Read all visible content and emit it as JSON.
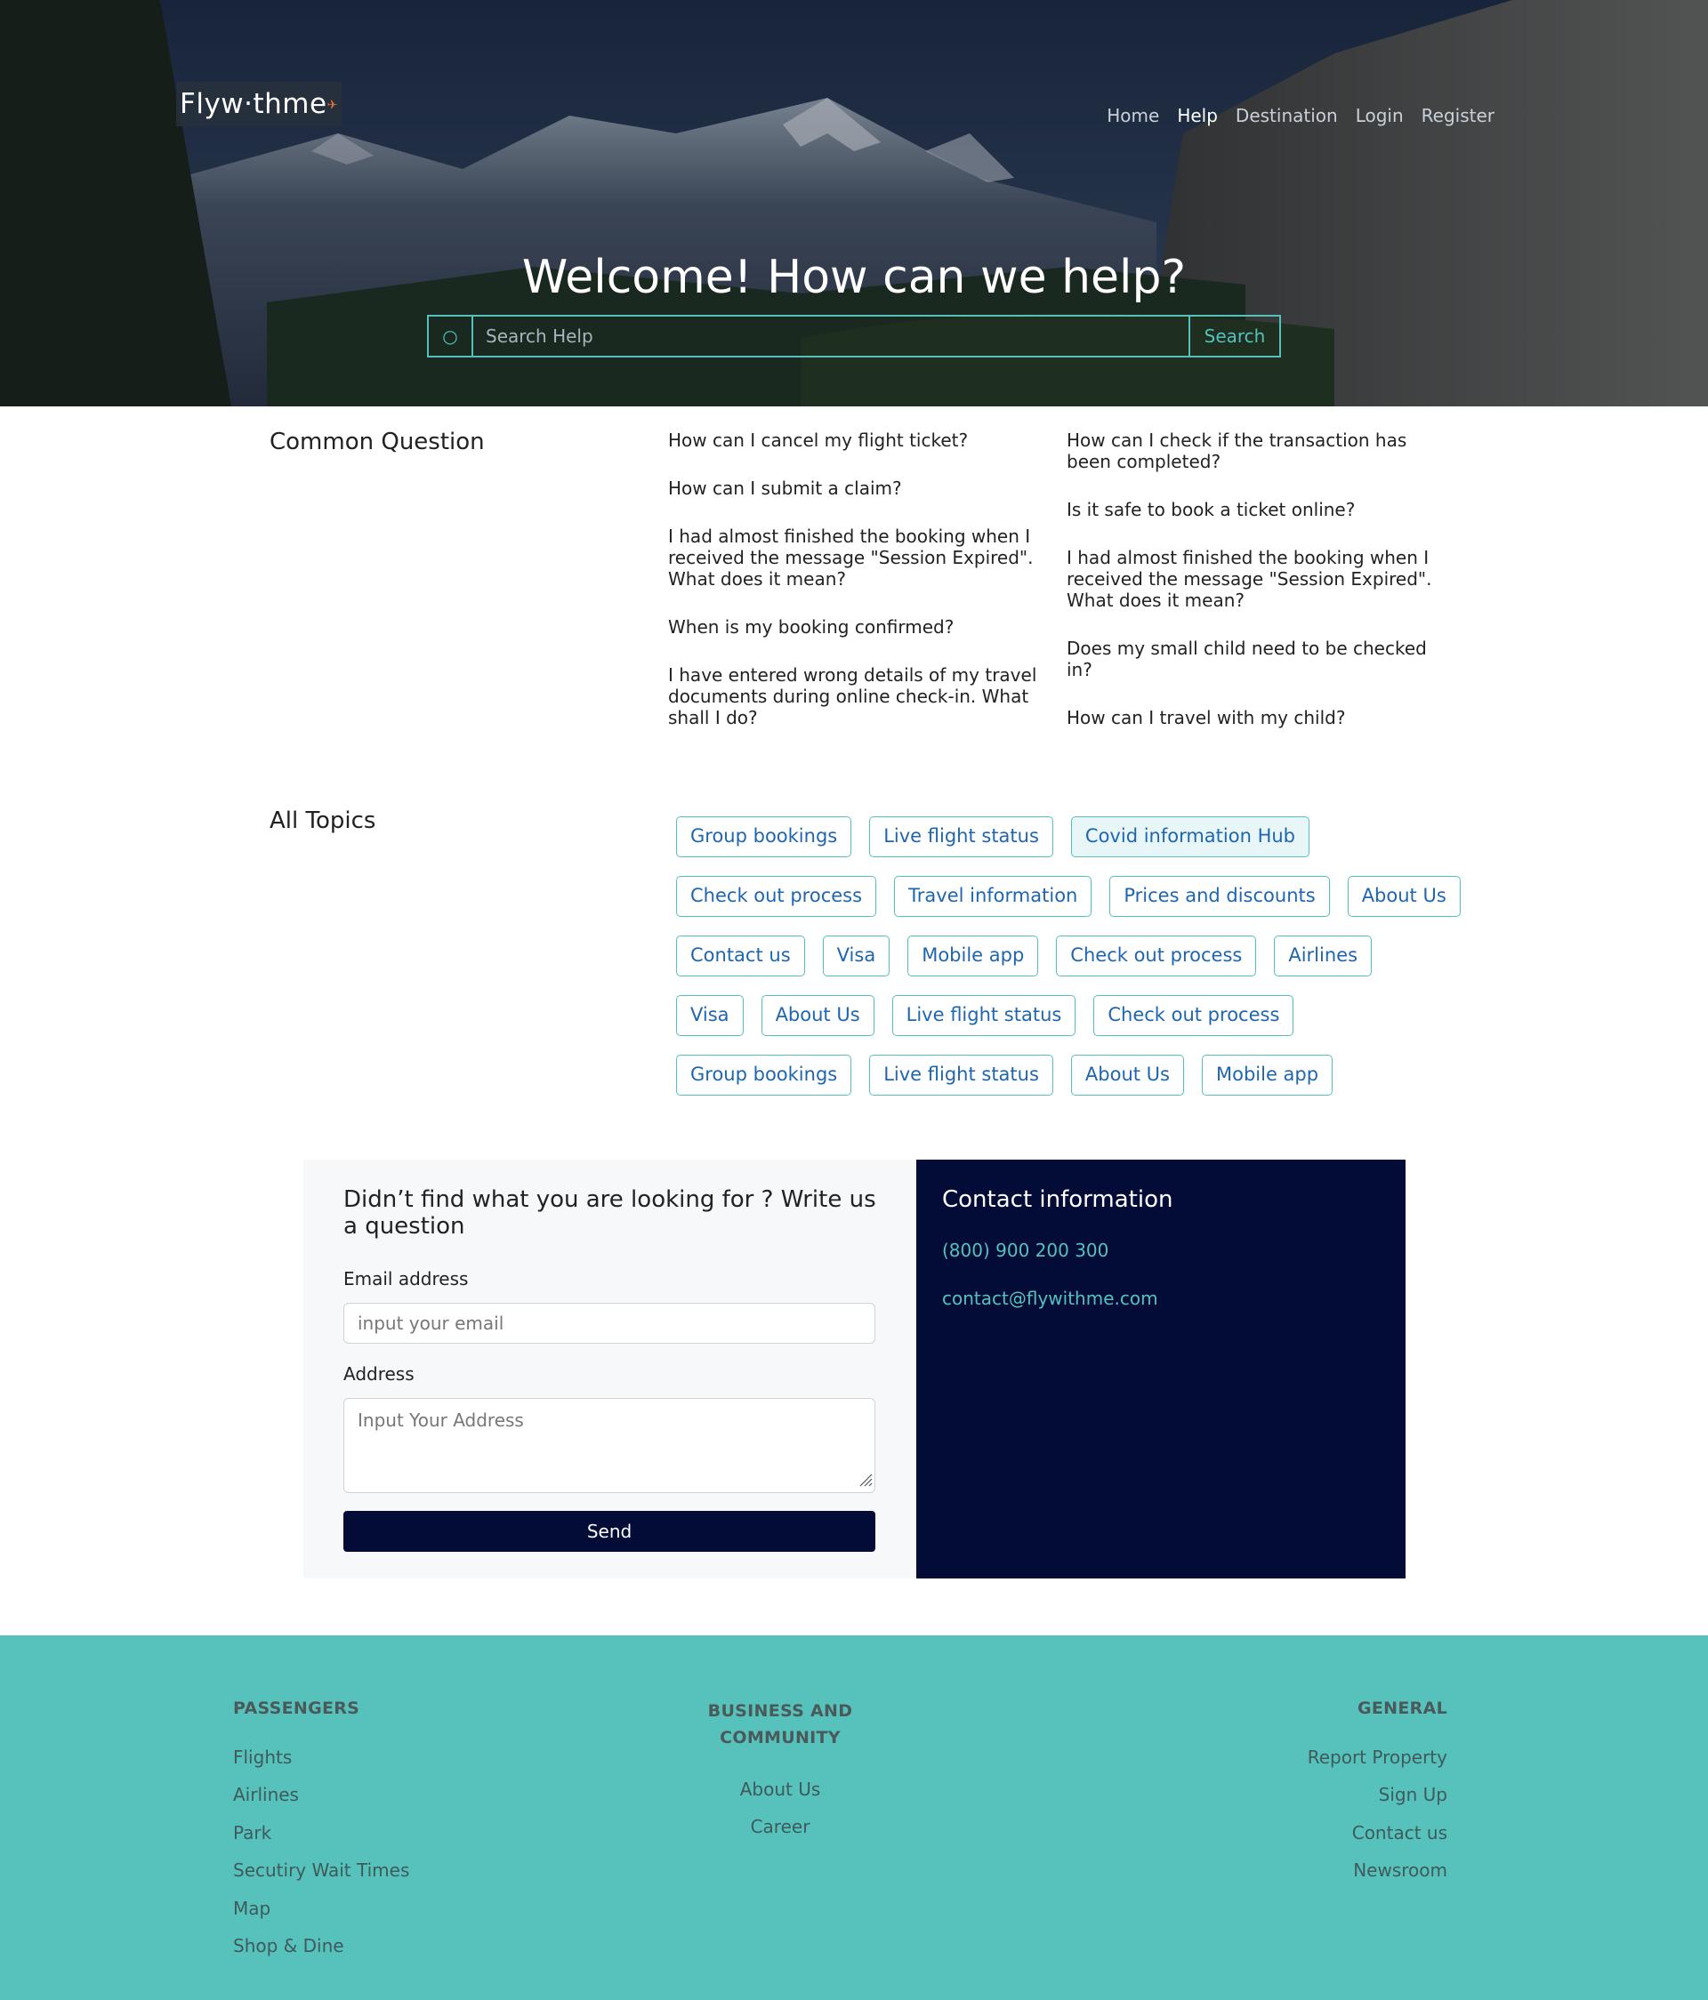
{
  "brand": {
    "logo_text": "Flyw·thme"
  },
  "nav": {
    "items": [
      {
        "label": "Home",
        "active": false
      },
      {
        "label": "Help",
        "active": true
      },
      {
        "label": "Destination",
        "active": false
      },
      {
        "label": "Login",
        "active": false
      },
      {
        "label": "Register",
        "active": false
      }
    ]
  },
  "hero": {
    "title": "Welcome! How can we help?",
    "search_placeholder": "Search Help",
    "search_button": "Search",
    "search_icon": "search-icon"
  },
  "common": {
    "title": "Common Question",
    "left": [
      "How can I cancel my flight ticket?",
      "How can I submit a claim?",
      "I had almost finished the booking when I received the message \"Session Expired\". What does it mean?",
      "When is my booking confirmed?",
      "I have entered wrong details of my travel documents during online check-in. What shall I do?"
    ],
    "right": [
      "How can I check if the transaction has been completed?",
      "Is it safe to book a ticket online?",
      "I had almost finished the booking when I received the message \"Session Expired\". What does it mean?",
      "Does my small child need to be checked in?",
      "How can I travel with my child?"
    ]
  },
  "topics": {
    "title": "All Topics",
    "rows": [
      [
        "Group bookings",
        "Live flight status",
        "Covid information Hub"
      ],
      [
        "Check out process",
        "Travel information",
        "Prices and discounts",
        "About Us"
      ],
      [
        "Contact us",
        "Visa",
        "Mobile app",
        "Check out process",
        "Airlines"
      ],
      [
        "Visa",
        "About Us",
        "Live flight status",
        "Check out process"
      ],
      [
        "Group bookings",
        "Live flight status",
        "About Us",
        "Mobile app"
      ]
    ],
    "highlighted": "Covid information Hub"
  },
  "ask": {
    "title": "Didn’t find what you are looking for ? Write us a question",
    "email_label": "Email address",
    "email_placeholder": "input your email",
    "address_label": "Address",
    "address_placeholder": "Input Your Address",
    "send_label": "Send"
  },
  "contact": {
    "title": "Contact information",
    "phone": "(800) 900 200 300",
    "email": "contact@flywithme.com"
  },
  "footer": {
    "passengers": {
      "title": "PASSENGERS",
      "links": [
        "Flights",
        "Airlines",
        "Park",
        "Secutiry Wait Times",
        "Map",
        "Shop & Dine"
      ]
    },
    "business": {
      "title_line1": "BUSINESS AND",
      "title_line2": "COMMUNITY",
      "links": [
        "About Us",
        "Career"
      ]
    },
    "general": {
      "title": "GENERAL",
      "links": [
        "Report Property",
        "Sign Up",
        "Contact us",
        "Newsroom"
      ]
    }
  },
  "colors": {
    "accent": "#55c1bc",
    "navy": "#030c36",
    "link_blue": "#1e66b0",
    "footer_bg": "#57c1bc"
  }
}
